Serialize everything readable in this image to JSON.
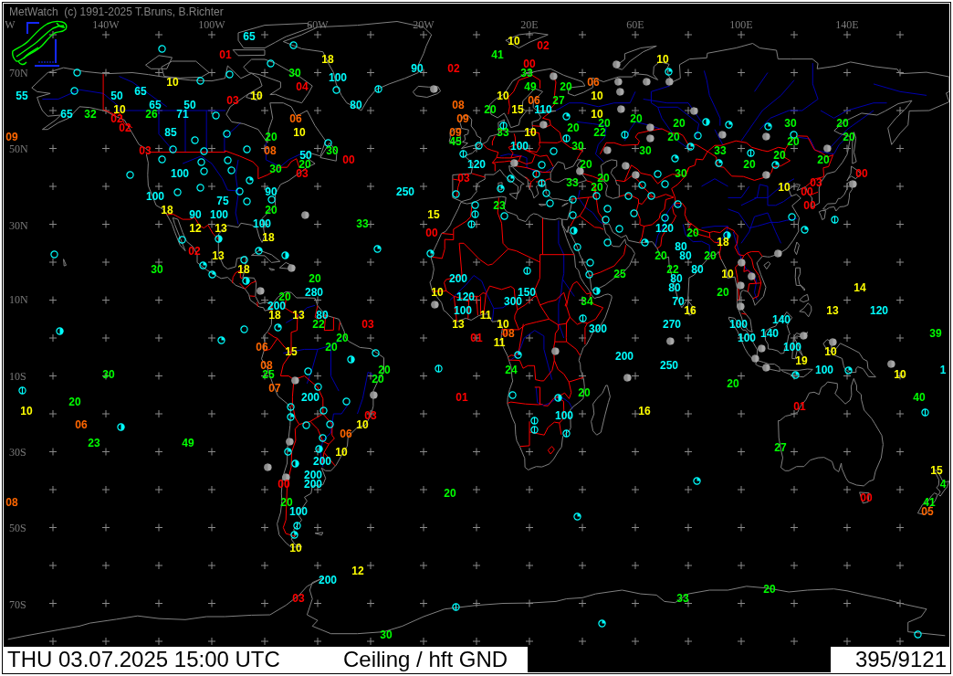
{
  "header": {
    "title": "MetWatch  (c) 1991-2025 T.Bruns, B.Richter"
  },
  "map": {
    "longitude_labels": [
      "W",
      "140W",
      "100W",
      "60W",
      "20W",
      "20E",
      "60E",
      "100E",
      "140E"
    ],
    "latitude_labels": [
      "70N",
      "50N",
      "30N",
      "10N",
      "10S",
      "30S",
      "50S",
      "70S"
    ],
    "station_values": [
      {
        "text": "65",
        "color": "#00ffff"
      },
      {
        "text": "10",
        "color": "#ffff00"
      },
      {
        "text": "02",
        "color": "#ff0000"
      },
      {
        "text": "01",
        "color": "#ff0000"
      },
      {
        "text": "41",
        "color": "#00ff00"
      },
      {
        "text": "18",
        "color": "#ffff00"
      },
      {
        "text": "10",
        "color": "#ffff00"
      },
      {
        "text": "00",
        "color": "#ff0000"
      },
      {
        "text": "90",
        "color": "#00ffff"
      },
      {
        "text": "02",
        "color": "#ff0000"
      },
      {
        "text": "30",
        "color": "#00ff00"
      },
      {
        "text": "33",
        "color": "#00ff00"
      },
      {
        "text": "100",
        "color": "#00ffff"
      },
      {
        "text": "10",
        "color": "#ffff00"
      },
      {
        "text": "06",
        "color": "#ff6600"
      },
      {
        "text": "04",
        "color": "#ff0000"
      },
      {
        "text": "49",
        "color": "#00ff00"
      },
      {
        "text": "20",
        "color": "#00ff00"
      },
      {
        "text": "65",
        "color": "#00ffff"
      },
      {
        "text": "55",
        "color": "#00ffff"
      },
      {
        "text": "50",
        "color": "#00ffff"
      },
      {
        "text": "10",
        "color": "#ffff00"
      },
      {
        "text": "10",
        "color": "#ffff00"
      },
      {
        "text": "10",
        "color": "#ffff00"
      },
      {
        "text": "03",
        "color": "#ff0000"
      },
      {
        "text": "06",
        "color": "#ff6600"
      },
      {
        "text": "27",
        "color": "#00ff00"
      },
      {
        "text": "65",
        "color": "#00ffff"
      },
      {
        "text": "50",
        "color": "#00ffff"
      },
      {
        "text": "80",
        "color": "#00ffff"
      },
      {
        "text": "08",
        "color": "#ff6600"
      },
      {
        "text": "10",
        "color": "#ffff00"
      },
      {
        "text": "20",
        "color": "#00ff00"
      },
      {
        "text": "15",
        "color": "#ffff00"
      },
      {
        "text": "110",
        "color": "#00ffff"
      },
      {
        "text": "65",
        "color": "#00ffff"
      },
      {
        "text": "32",
        "color": "#00ff00"
      },
      {
        "text": "26",
        "color": "#00ff00"
      },
      {
        "text": "71",
        "color": "#00ffff"
      },
      {
        "text": "10",
        "color": "#ffff00"
      },
      {
        "text": "02",
        "color": "#ff0000"
      },
      {
        "text": "06",
        "color": "#ff6600"
      },
      {
        "text": "09",
        "color": "#ff6600"
      },
      {
        "text": "20",
        "color": "#00ff00"
      },
      {
        "text": "20",
        "color": "#00ff00"
      },
      {
        "text": "20",
        "color": "#00ff00"
      },
      {
        "text": "30",
        "color": "#00ff00"
      },
      {
        "text": "20",
        "color": "#00ff00"
      },
      {
        "text": "02",
        "color": "#ff0000"
      },
      {
        "text": "20",
        "color": "#00ff00"
      },
      {
        "text": "85",
        "color": "#00ffff"
      },
      {
        "text": "10",
        "color": "#ffff00"
      },
      {
        "text": "09",
        "color": "#ff6600"
      },
      {
        "text": "33",
        "color": "#00ff00"
      },
      {
        "text": "10",
        "color": "#ffff00"
      },
      {
        "text": "22",
        "color": "#00ff00"
      },
      {
        "text": "09",
        "color": "#ff6600"
      },
      {
        "text": "20",
        "color": "#00ff00"
      },
      {
        "text": "20",
        "color": "#00ff00"
      },
      {
        "text": "20",
        "color": "#00ff00"
      },
      {
        "text": "45",
        "color": "#00ff00"
      },
      {
        "text": "20",
        "color": "#00ff00"
      },
      {
        "text": "100",
        "color": "#00ffff"
      },
      {
        "text": "30",
        "color": "#00ff00"
      },
      {
        "text": "03",
        "color": "#ff0000"
      },
      {
        "text": "08",
        "color": "#ff6600"
      },
      {
        "text": "30",
        "color": "#00ff00"
      },
      {
        "text": "30",
        "color": "#00ff00"
      },
      {
        "text": "33",
        "color": "#00ff00"
      },
      {
        "text": "50",
        "color": "#00ffff"
      },
      {
        "text": "20",
        "color": "#00ff00"
      },
      {
        "text": "00",
        "color": "#ff0000"
      },
      {
        "text": "20",
        "color": "#00ff00"
      },
      {
        "text": "20",
        "color": "#00ff00"
      },
      {
        "text": "120",
        "color": "#00ffff"
      },
      {
        "text": "20",
        "color": "#00ff00"
      },
      {
        "text": "20",
        "color": "#00ff00"
      },
      {
        "text": "30",
        "color": "#00ff00"
      },
      {
        "text": "100",
        "color": "#00ffff"
      },
      {
        "text": "03",
        "color": "#ff0000"
      },
      {
        "text": "30",
        "color": "#00ff00"
      },
      {
        "text": "00",
        "color": "#ff0000"
      },
      {
        "text": "03",
        "color": "#ff0000"
      },
      {
        "text": "20",
        "color": "#00ff00"
      },
      {
        "text": "33",
        "color": "#00ff00"
      },
      {
        "text": "03",
        "color": "#ff0000"
      },
      {
        "text": "20",
        "color": "#00ff00"
      },
      {
        "text": "10",
        "color": "#ffff00"
      },
      {
        "text": "90",
        "color": "#00ffff"
      },
      {
        "text": "250",
        "color": "#00ffff"
      },
      {
        "text": "00",
        "color": "#ff0000"
      },
      {
        "text": "100",
        "color": "#00ffff"
      },
      {
        "text": "75",
        "color": "#00ffff"
      },
      {
        "text": "23",
        "color": "#00ff00"
      },
      {
        "text": "00",
        "color": "#ff0000"
      },
      {
        "text": "18",
        "color": "#ffff00"
      },
      {
        "text": "20",
        "color": "#00ff00"
      },
      {
        "text": "90",
        "color": "#00ffff"
      },
      {
        "text": "100",
        "color": "#00ffff"
      },
      {
        "text": "15",
        "color": "#ffff00"
      },
      {
        "text": "100",
        "color": "#00ffff"
      },
      {
        "text": "33",
        "color": "#00ff00"
      },
      {
        "text": "12",
        "color": "#ffff00"
      },
      {
        "text": "13",
        "color": "#ffff00"
      },
      {
        "text": "120",
        "color": "#00ffff"
      },
      {
        "text": "00",
        "color": "#ff0000"
      },
      {
        "text": "20",
        "color": "#00ff00"
      },
      {
        "text": "18",
        "color": "#ffff00"
      },
      {
        "text": "18",
        "color": "#ffff00"
      },
      {
        "text": "80",
        "color": "#00ffff"
      },
      {
        "text": "02",
        "color": "#ff0000"
      },
      {
        "text": "13",
        "color": "#ffff00"
      },
      {
        "text": "20",
        "color": "#00ff00"
      },
      {
        "text": "80",
        "color": "#00ffff"
      },
      {
        "text": "20",
        "color": "#00ff00"
      },
      {
        "text": "30",
        "color": "#00ff00"
      },
      {
        "text": "18",
        "color": "#ffff00"
      },
      {
        "text": "22",
        "color": "#00ff00"
      },
      {
        "text": "80",
        "color": "#00ffff"
      },
      {
        "text": "25",
        "color": "#00ff00"
      },
      {
        "text": "10",
        "color": "#ffff00"
      },
      {
        "text": "20",
        "color": "#00ff00"
      },
      {
        "text": "200",
        "color": "#00ffff"
      },
      {
        "text": "80",
        "color": "#00ffff"
      },
      {
        "text": "80",
        "color": "#00ffff"
      },
      {
        "text": "14",
        "color": "#ffff00"
      },
      {
        "text": "280",
        "color": "#00ffff"
      },
      {
        "text": "10",
        "color": "#ffff00"
      },
      {
        "text": "150",
        "color": "#00ffff"
      },
      {
        "text": "20",
        "color": "#00ff00"
      },
      {
        "text": "20",
        "color": "#00ff00"
      },
      {
        "text": "120",
        "color": "#00ffff"
      },
      {
        "text": "300",
        "color": "#00ffff"
      },
      {
        "text": "34",
        "color": "#00ff00"
      },
      {
        "text": "70",
        "color": "#00ffff"
      },
      {
        "text": "200",
        "color": "#00ffff"
      },
      {
        "text": "100",
        "color": "#00ffff"
      },
      {
        "text": "16",
        "color": "#ffff00"
      },
      {
        "text": "13",
        "color": "#ffff00"
      },
      {
        "text": "120",
        "color": "#00ffff"
      },
      {
        "text": "18",
        "color": "#ffff00"
      },
      {
        "text": "13",
        "color": "#ffff00"
      },
      {
        "text": "80",
        "color": "#00ffff"
      },
      {
        "text": "11",
        "color": "#ffff00"
      },
      {
        "text": "140",
        "color": "#00ffff"
      },
      {
        "text": "22",
        "color": "#00ff00"
      },
      {
        "text": "03",
        "color": "#ff0000"
      },
      {
        "text": "13",
        "color": "#ffff00"
      },
      {
        "text": "10",
        "color": "#ffff00"
      },
      {
        "text": "270",
        "color": "#00ffff"
      },
      {
        "text": "100",
        "color": "#00ffff"
      },
      {
        "text": "300",
        "color": "#00ffff"
      },
      {
        "text": "08",
        "color": "#ff6600"
      },
      {
        "text": "140",
        "color": "#00ffff"
      },
      {
        "text": "39",
        "color": "#00ff00"
      },
      {
        "text": "20",
        "color": "#00ff00"
      },
      {
        "text": "01",
        "color": "#ff0000"
      },
      {
        "text": "100",
        "color": "#00ffff"
      },
      {
        "text": "11",
        "color": "#ffff00"
      },
      {
        "text": "06",
        "color": "#ff6600"
      },
      {
        "text": "20",
        "color": "#00ff00"
      },
      {
        "text": "100",
        "color": "#00ffff"
      },
      {
        "text": "15",
        "color": "#ffff00"
      },
      {
        "text": "10",
        "color": "#ffff00"
      },
      {
        "text": "200",
        "color": "#00ffff"
      },
      {
        "text": "19",
        "color": "#ffff00"
      },
      {
        "text": "08",
        "color": "#ff6600"
      },
      {
        "text": "250",
        "color": "#00ffff"
      },
      {
        "text": "20",
        "color": "#00ff00"
      },
      {
        "text": "24",
        "color": "#00ff00"
      },
      {
        "text": "100",
        "color": "#00ffff"
      },
      {
        "text": "1",
        "color": "#00ffff"
      },
      {
        "text": "30",
        "color": "#00ff00"
      },
      {
        "text": "25",
        "color": "#00ff00"
      },
      {
        "text": "10",
        "color": "#ffff00"
      },
      {
        "text": "20",
        "color": "#00ff00"
      },
      {
        "text": "20",
        "color": "#00ff00"
      },
      {
        "text": "07",
        "color": "#ff6600"
      },
      {
        "text": "20",
        "color": "#00ff00"
      },
      {
        "text": "200",
        "color": "#00ffff"
      },
      {
        "text": "01",
        "color": "#ff0000"
      },
      {
        "text": "40",
        "color": "#00ff00"
      },
      {
        "text": "20",
        "color": "#00ff00"
      },
      {
        "text": "01",
        "color": "#ff0000"
      },
      {
        "text": "10",
        "color": "#ffff00"
      },
      {
        "text": "16",
        "color": "#ffff00"
      },
      {
        "text": "03",
        "color": "#ff0000"
      },
      {
        "text": "100",
        "color": "#00ffff"
      },
      {
        "text": "06",
        "color": "#ff6600"
      },
      {
        "text": "10",
        "color": "#ffff00"
      },
      {
        "text": "06",
        "color": "#ff6600"
      },
      {
        "text": "23",
        "color": "#00ff00"
      },
      {
        "text": "49",
        "color": "#00ff00"
      },
      {
        "text": "27",
        "color": "#00ff00"
      },
      {
        "text": "10",
        "color": "#ffff00"
      },
      {
        "text": "200",
        "color": "#00ffff"
      },
      {
        "text": "15",
        "color": "#ffff00"
      },
      {
        "text": "200",
        "color": "#00ffff"
      },
      {
        "text": "00",
        "color": "#ff0000"
      },
      {
        "text": "200",
        "color": "#00ffff"
      },
      {
        "text": "4",
        "color": "#00ff00"
      },
      {
        "text": "20",
        "color": "#00ff00"
      },
      {
        "text": "00",
        "color": "#ff0000"
      },
      {
        "text": "08",
        "color": "#ff6600"
      },
      {
        "text": "20",
        "color": "#00ff00"
      },
      {
        "text": "41",
        "color": "#00ff00"
      },
      {
        "text": "100",
        "color": "#00ffff"
      },
      {
        "text": "05",
        "color": "#ff6600"
      },
      {
        "text": "10",
        "color": "#ffff00"
      },
      {
        "text": "12",
        "color": "#ffff00"
      },
      {
        "text": "200",
        "color": "#00ffff"
      },
      {
        "text": "20",
        "color": "#00ff00"
      },
      {
        "text": "03",
        "color": "#ff0000"
      },
      {
        "text": "33",
        "color": "#00ff00"
      },
      {
        "text": "30",
        "color": "#00ff00"
      }
    ],
    "station_markers": [
      {
        "kind": "ring"
      },
      {
        "kind": "ring"
      },
      {
        "kind": "ring"
      },
      {
        "kind": "filled"
      },
      {
        "kind": "quarter"
      },
      {
        "kind": "ring"
      },
      {
        "kind": "ring"
      },
      {
        "kind": "filled"
      },
      {
        "kind": "ring"
      },
      {
        "kind": "filled"
      },
      {
        "kind": "filled"
      },
      {
        "kind": "filled"
      },
      {
        "kind": "filled"
      },
      {
        "kind": "bar"
      },
      {
        "kind": "ring"
      },
      {
        "kind": "ring"
      },
      {
        "kind": "filled"
      },
      {
        "kind": "filled"
      },
      {
        "kind": "filled"
      },
      {
        "kind": "ring"
      },
      {
        "kind": "quarter"
      },
      {
        "kind": "half"
      },
      {
        "kind": "filled"
      },
      {
        "kind": "quarter"
      },
      {
        "kind": "bar"
      },
      {
        "kind": "quarter"
      },
      {
        "kind": "filled"
      },
      {
        "kind": "ring"
      },
      {
        "kind": "bar"
      },
      {
        "kind": "filled"
      },
      {
        "kind": "ring"
      },
      {
        "kind": "ring"
      },
      {
        "kind": "filled"
      },
      {
        "kind": "bar"
      },
      {
        "kind": "filled"
      },
      {
        "kind": "ring"
      },
      {
        "kind": "ring"
      },
      {
        "kind": "ring"
      },
      {
        "kind": "quarter"
      },
      {
        "kind": "filled"
      },
      {
        "kind": "ring"
      },
      {
        "kind": "ring"
      },
      {
        "kind": "filled"
      },
      {
        "kind": "ring"
      },
      {
        "kind": "ring"
      },
      {
        "kind": "bar"
      },
      {
        "kind": "bar"
      },
      {
        "kind": "quarter"
      },
      {
        "kind": "ring"
      },
      {
        "kind": "ring"
      },
      {
        "kind": "ring"
      },
      {
        "kind": "filled"
      },
      {
        "kind": "quarter"
      },
      {
        "kind": "ring"
      },
      {
        "kind": "quarter"
      },
      {
        "kind": "filled"
      },
      {
        "kind": "ring"
      },
      {
        "kind": "ring"
      },
      {
        "kind": "filled"
      },
      {
        "kind": "ring"
      },
      {
        "kind": "ring"
      },
      {
        "kind": "ring"
      },
      {
        "kind": "filled"
      },
      {
        "kind": "filled"
      },
      {
        "kind": "quarter"
      },
      {
        "kind": "quarter"
      },
      {
        "kind": "bar"
      },
      {
        "kind": "ring"
      },
      {
        "kind": "filled"
      },
      {
        "kind": "ring"
      },
      {
        "kind": "ring"
      },
      {
        "kind": "quarter"
      },
      {
        "kind": "ring"
      },
      {
        "kind": "ring"
      },
      {
        "kind": "ring"
      },
      {
        "kind": "ring"
      },
      {
        "kind": "ring"
      },
      {
        "kind": "ring"
      },
      {
        "kind": "ring"
      },
      {
        "kind": "ring"
      },
      {
        "kind": "ring"
      },
      {
        "kind": "ring"
      },
      {
        "kind": "ring"
      },
      {
        "kind": "ring"
      },
      {
        "kind": "ring"
      },
      {
        "kind": "ring"
      },
      {
        "kind": "ring"
      },
      {
        "kind": "bar"
      },
      {
        "kind": "filled"
      },
      {
        "kind": "ring"
      },
      {
        "kind": "ring"
      },
      {
        "kind": "ring"
      },
      {
        "kind": "ring"
      },
      {
        "kind": "ring"
      },
      {
        "kind": "bar"
      },
      {
        "kind": "bar"
      },
      {
        "kind": "ring"
      },
      {
        "kind": "quarter"
      },
      {
        "kind": "half"
      },
      {
        "kind": "half"
      },
      {
        "kind": "half"
      },
      {
        "kind": "ring"
      },
      {
        "kind": "ring"
      },
      {
        "kind": "quarter"
      },
      {
        "kind": "ring"
      },
      {
        "kind": "quarter"
      },
      {
        "kind": "quarter"
      },
      {
        "kind": "filled"
      },
      {
        "kind": "quarter"
      },
      {
        "kind": "ring"
      },
      {
        "kind": "half"
      },
      {
        "kind": "ring"
      },
      {
        "kind": "filled"
      },
      {
        "kind": "ring"
      },
      {
        "kind": "quarter"
      },
      {
        "kind": "filled"
      },
      {
        "kind": "bar"
      },
      {
        "kind": "ring"
      },
      {
        "kind": "quarter"
      },
      {
        "kind": "filled"
      },
      {
        "kind": "half"
      },
      {
        "kind": "filled"
      },
      {
        "kind": "half"
      },
      {
        "kind": "filled"
      },
      {
        "kind": "filled"
      },
      {
        "kind": "filled"
      },
      {
        "kind": "bar"
      },
      {
        "kind": "quarter"
      },
      {
        "kind": "ring"
      },
      {
        "kind": "half"
      },
      {
        "kind": "filled"
      },
      {
        "kind": "quarter"
      },
      {
        "kind": "filled"
      },
      {
        "kind": "filled"
      },
      {
        "kind": "filled"
      },
      {
        "kind": "filled"
      },
      {
        "kind": "ring"
      },
      {
        "kind": "quarter"
      },
      {
        "kind": "filled"
      },
      {
        "kind": "half"
      },
      {
        "kind": "filled"
      },
      {
        "kind": "filled"
      },
      {
        "kind": "bar"
      },
      {
        "kind": "quarter"
      },
      {
        "kind": "ring"
      },
      {
        "kind": "quarter"
      },
      {
        "kind": "filled"
      },
      {
        "kind": "filled"
      },
      {
        "kind": "ring"
      },
      {
        "kind": "bar"
      },
      {
        "kind": "filled"
      },
      {
        "kind": "ring"
      },
      {
        "kind": "half"
      },
      {
        "kind": "ring"
      },
      {
        "kind": "ring"
      },
      {
        "kind": "ring"
      },
      {
        "kind": "bar"
      },
      {
        "kind": "quarter"
      },
      {
        "kind": "bar"
      },
      {
        "kind": "ring"
      },
      {
        "kind": "ring"
      },
      {
        "kind": "half"
      },
      {
        "kind": "bar"
      },
      {
        "kind": "bar"
      },
      {
        "kind": "ring"
      },
      {
        "kind": "filled"
      },
      {
        "kind": "half"
      },
      {
        "kind": "quarter"
      },
      {
        "kind": "half"
      },
      {
        "kind": "filled"
      },
      {
        "kind": "filled"
      },
      {
        "kind": "quarter"
      },
      {
        "kind": "quarter"
      },
      {
        "kind": "bar"
      },
      {
        "kind": "quarter"
      },
      {
        "kind": "bar"
      },
      {
        "kind": "quarter"
      },
      {
        "kind": "ring"
      }
    ]
  },
  "status_bar": {
    "datetime": "THU 03.07.2025 15:00 UTC",
    "parameter": "Ceiling / hft GND",
    "count": "395/9121"
  }
}
